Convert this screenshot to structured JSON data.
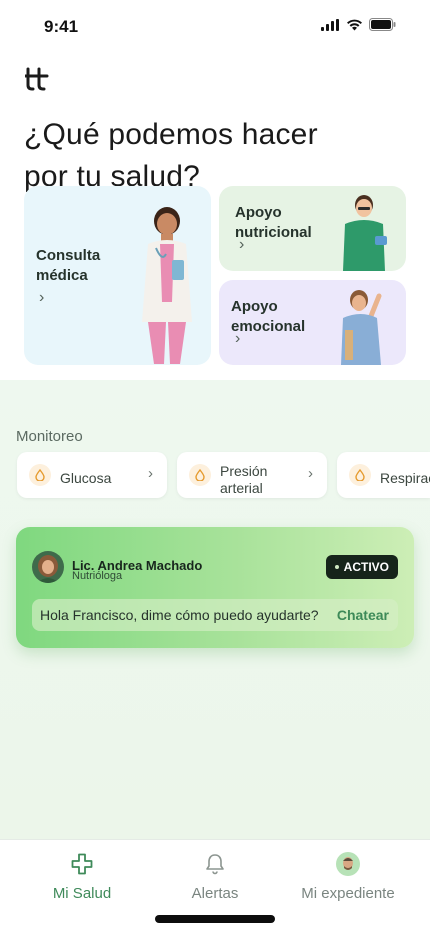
{
  "status_bar": {
    "time": "9:41"
  },
  "headline": "¿Qué podemos hacer\npor tu salud?",
  "cards": {
    "consulta": "Consulta\nmédica",
    "nutricional": "Apoyo\nnutricional",
    "emocional": "Apoyo\nemocional"
  },
  "monitoreo": {
    "title": "Monitoreo",
    "items": [
      {
        "label": "Glucosa"
      },
      {
        "label": "Presión\narterial"
      },
      {
        "label": "Respiración"
      }
    ]
  },
  "assistant": {
    "name": "Lic. Andrea Machado",
    "role": "Nutrióloga",
    "status": "ACTIVO",
    "message": "Hola Francisco, dime cómo puedo ayudarte?",
    "action": "Chatear"
  },
  "tabs": [
    {
      "label": "Mi Salud",
      "icon": "medical-cross-icon",
      "active": true
    },
    {
      "label": "Alertas",
      "icon": "bell-icon",
      "active": false
    },
    {
      "label": "Mi expediente",
      "icon": "avatar-icon",
      "active": false
    }
  ],
  "colors": {
    "accent": "#3f8a5a",
    "assistant_card": "#8edb88",
    "badge": "#16241a"
  }
}
